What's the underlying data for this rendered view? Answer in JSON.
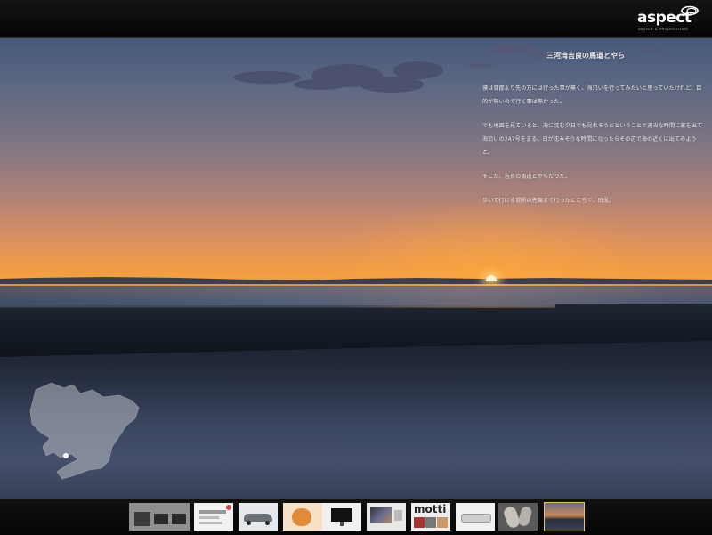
{
  "brand": {
    "logo_text": "aspect",
    "logo_sub": "DESIGN & PRODUCTIONS"
  },
  "article": {
    "title": "三河湾吉良の馬道とやら",
    "paragraphs": [
      "僕は蒲郡より先の方には行った事が無く、海沿いを行ってみたいと思っていたけれど、目的が無いので行く事は無かった。",
      "でも地図を見ていると、海に沈む夕日でも見れそうだということで適当な時間に家を出て海沿いの247号をまる。日が沈みそうな時間になったらその辺で海の近くに出てみようと。",
      "そこが、吉良の馬道とやらだった。",
      "歩いて行ける堤防の先端まで行ったところで、日没。"
    ]
  },
  "map": {
    "region_icon": "aichi-map-icon",
    "fill": "#b9bcc4"
  },
  "thumbnails": [
    {
      "name": "thumb-1-devices",
      "bg": "#9a9a9a",
      "active": false
    },
    {
      "name": "thumb-2-document",
      "bg": "#f2f2f2",
      "active": false
    },
    {
      "name": "thumb-3-car",
      "bg": "#e6e8ec",
      "active": false
    },
    {
      "name": "thumb-4-food",
      "bg": "#f3d8b8",
      "active": false
    },
    {
      "name": "thumb-5-monitor",
      "bg": "#f0f0f0",
      "active": false
    },
    {
      "name": "thumb-6-screen",
      "bg": "#e8e8e8",
      "active": false
    },
    {
      "name": "thumb-7-motti",
      "bg": "#efefef",
      "label": "motti",
      "active": false
    },
    {
      "name": "thumb-8-device",
      "bg": "#f1f1f1",
      "active": false
    },
    {
      "name": "thumb-9-hands",
      "bg": "#6c6c6c",
      "active": false
    },
    {
      "name": "thumb-10-sunset",
      "bg": "#8a6d5c",
      "active": true
    }
  ],
  "colors": {
    "accent": "#e8c45a"
  }
}
